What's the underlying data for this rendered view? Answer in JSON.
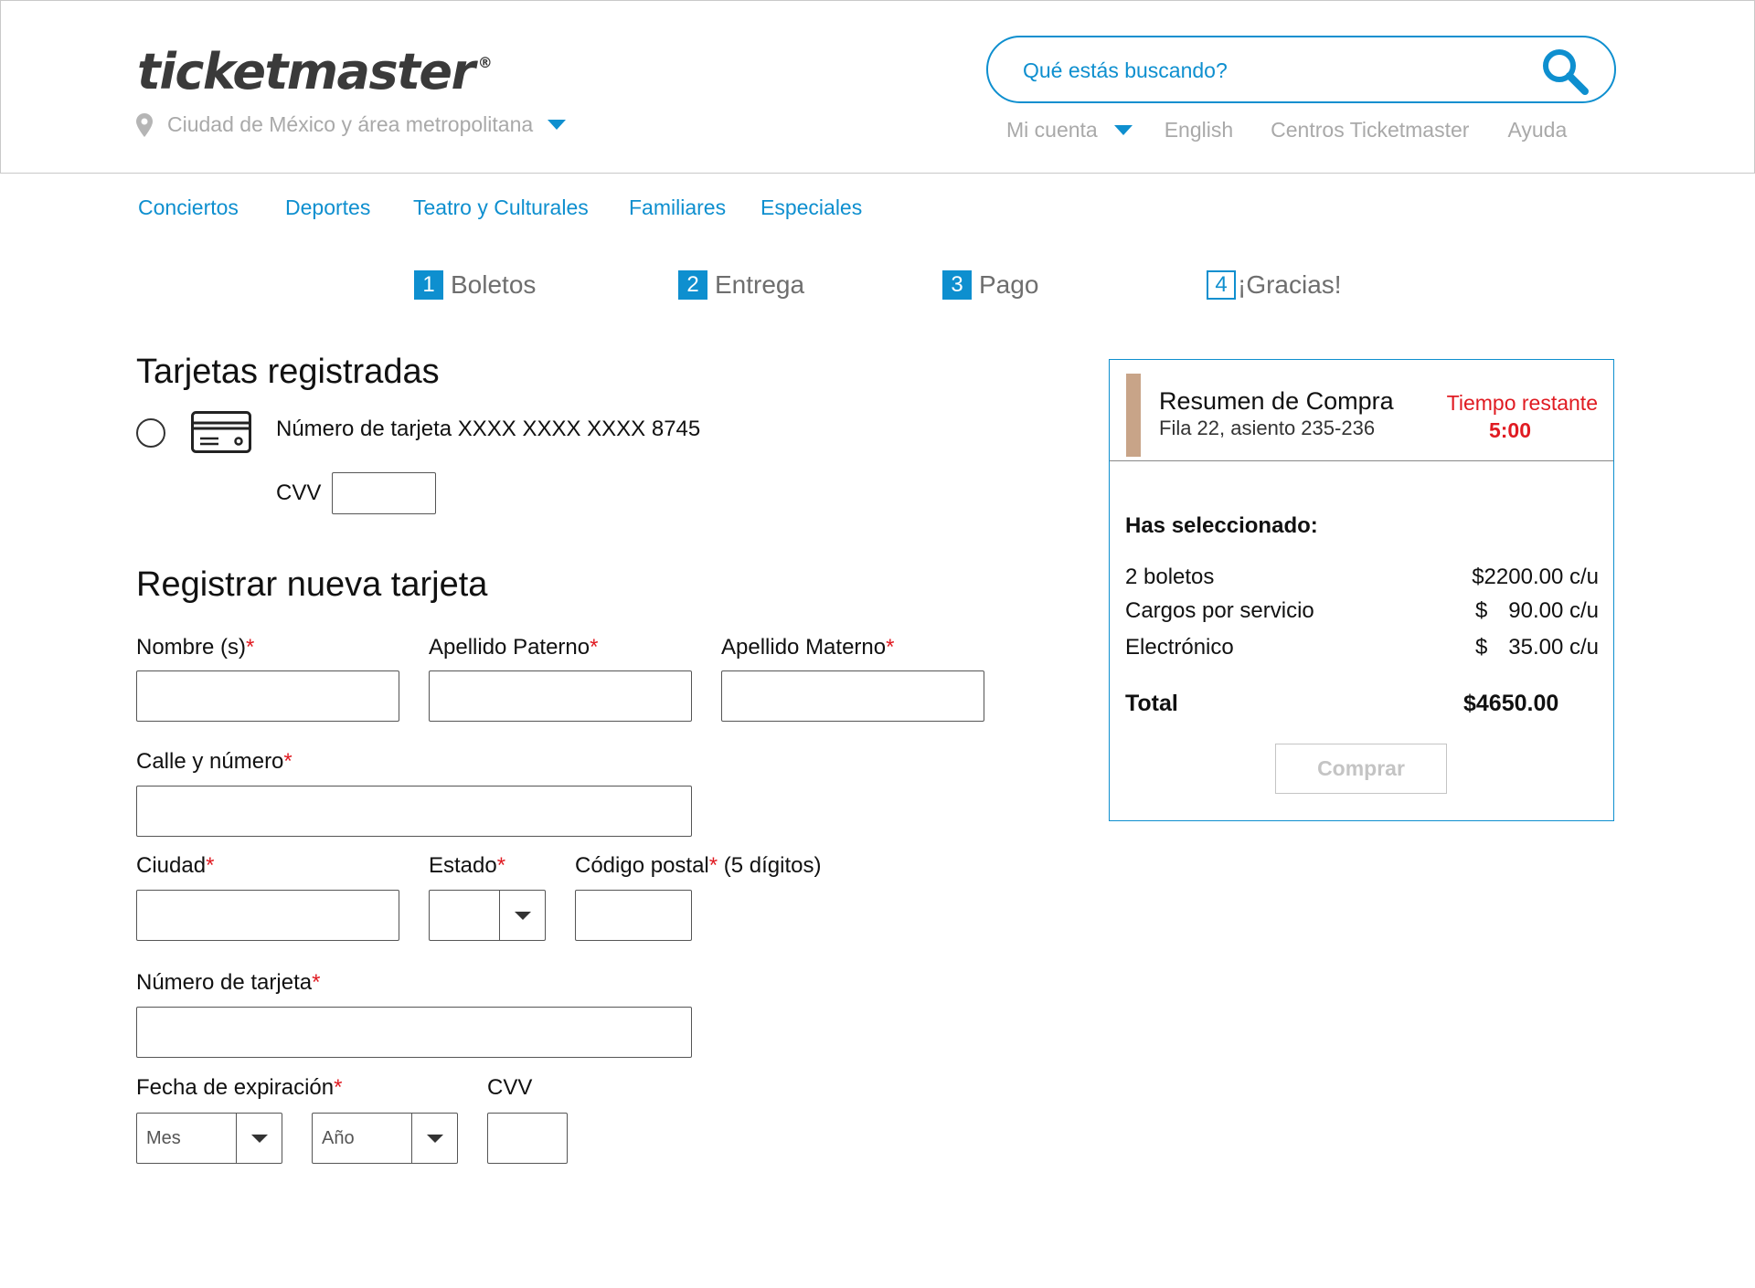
{
  "header": {
    "logo_text": "ticketmaster",
    "logo_reg": "®",
    "location": "Ciudad de México y área metropolitana",
    "search_placeholder": "Qué estás buscando?",
    "links": {
      "account": "Mi cuenta",
      "language": "English",
      "centers": "Centros Ticketmaster",
      "help": "Ayuda"
    }
  },
  "categories": [
    "Conciertos",
    "Deportes",
    "Teatro y Culturales",
    "Familiares",
    "Especiales"
  ],
  "steps": [
    {
      "num": "1",
      "label": "Boletos"
    },
    {
      "num": "2",
      "label": "Entrega"
    },
    {
      "num": "3",
      "label": "Pago"
    },
    {
      "num": "4",
      "label": "¡Gracias!"
    }
  ],
  "saved_cards": {
    "title": "Tarjetas registradas",
    "card_text": "Número de tarjeta XXXX XXXX XXXX 8745",
    "cvv_label": "CVV"
  },
  "new_card": {
    "title": "Registrar nueva tarjeta",
    "required_mark": "*",
    "first_name_label": "Nombre (s)",
    "last_name_label": "Apellido Paterno",
    "mother_name_label": "Apellido Materno",
    "street_label": "Calle y número",
    "city_label": "Ciudad",
    "state_label": "Estado",
    "zip_label": "Código postal",
    "zip_hint": " (5 dígitos)",
    "card_number_label": "Número de tarjeta",
    "expiration_label": "Fecha de expiración",
    "month_value": "Mes",
    "year_value": "Año",
    "cvv_label": "CVV"
  },
  "summary": {
    "title": "Resumen de Compra",
    "seats": "Fila 22, asiento 235-236",
    "timer_label": "Tiempo restante",
    "timer_value": "5:00",
    "selected_label": "Has seleccionado:",
    "rows": [
      {
        "label": "2 boletos",
        "currency": "",
        "amount": "$2200.00 c/u"
      },
      {
        "label": "Cargos por servicio",
        "currency": "$",
        "amount": "90.00 c/u"
      },
      {
        "label": "Electrónico",
        "currency": "$",
        "amount": "35.00 c/u"
      }
    ],
    "total_label": "Total",
    "total_value": "$4650.00",
    "buy_button": "Comprar"
  },
  "colors": {
    "accent": "#0e8fcf",
    "required": "#e01b22",
    "muted": "#a9a9a9",
    "summary_bar": "#c8a488"
  }
}
